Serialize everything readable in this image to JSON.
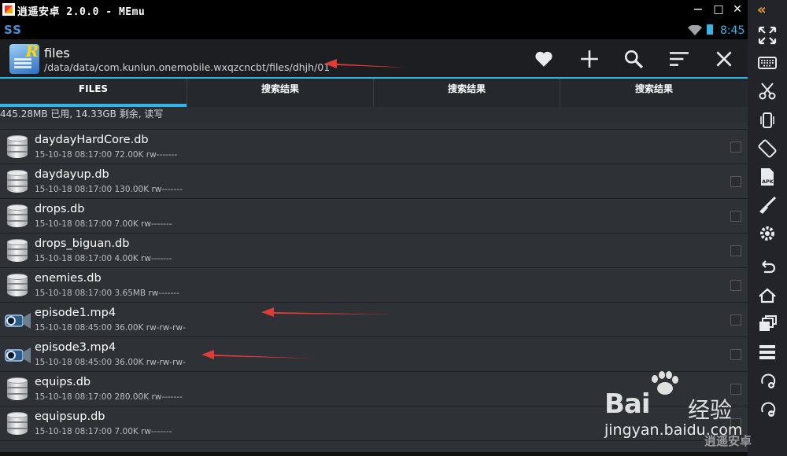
{
  "window": {
    "title": "逍遥安卓 2.0.0 - MEmu",
    "minimize": "−",
    "maximize": "□",
    "close": "✕"
  },
  "statusbar": {
    "indicator": "SS",
    "time": "8:45"
  },
  "actionbar": {
    "title": "files",
    "path": "/data/data/com.kunlun.onemobile.wxqzcncbt/files/dhjh/01",
    "app_icon_letter": "R"
  },
  "tabs": [
    {
      "label": "FILES",
      "active": true
    },
    {
      "label": "搜索结果",
      "active": false
    },
    {
      "label": "搜索结果",
      "active": false
    },
    {
      "label": "搜索结果",
      "active": false
    }
  ],
  "storage_info": "445.28MB 已用, 14.33GB 剩余, 读写",
  "files": [
    {
      "name": "daydayHardCore.db",
      "meta": "15-10-18 08:17:00  72.00K  rw-------",
      "type": "db"
    },
    {
      "name": "daydayup.db",
      "meta": "15-10-18 08:17:00  130.00K  rw-------",
      "type": "db"
    },
    {
      "name": "drops.db",
      "meta": "15-10-18 08:17:00  7.00K  rw-------",
      "type": "db"
    },
    {
      "name": "drops_biguan.db",
      "meta": "15-10-18 08:17:00  4.00K  rw-------",
      "type": "db"
    },
    {
      "name": "enemies.db",
      "meta": "15-10-18 08:17:00  3.65MB  rw-------",
      "type": "db"
    },
    {
      "name": "episode1.mp4",
      "meta": "15-10-18 08:45:00  36.00K  rw-rw-rw-",
      "type": "video"
    },
    {
      "name": "episode3.mp4",
      "meta": "15-10-18 08:45:00  36.00K  rw-rw-rw-",
      "type": "video"
    },
    {
      "name": "equips.db",
      "meta": "15-10-18 08:17:00  280.00K  rw-------",
      "type": "db"
    },
    {
      "name": "equipsup.db",
      "meta": "15-10-18 08:17:00  7.00K  rw-------",
      "type": "db"
    }
  ],
  "sidebar": {
    "collapse": "«",
    "icons": [
      "fullscreen-icon",
      "keyboard-icon",
      "scissors-icon",
      "shake-icon",
      "rotate-icon",
      "apk-icon",
      "brush-icon",
      "settings-icon",
      "back-icon",
      "home-icon",
      "recent-apps-icon",
      "menu-icon",
      "volume-up-icon",
      "volume-down-icon"
    ]
  },
  "watermark": {
    "brand": "Bai",
    "brand_cn": "经验",
    "url": "jingyan.baidu.com"
  },
  "corner_logo": "逍遥安卓",
  "colors": {
    "accent": "#33b5e5",
    "arrow": "#e53935",
    "list_bg": "#2e3136"
  }
}
